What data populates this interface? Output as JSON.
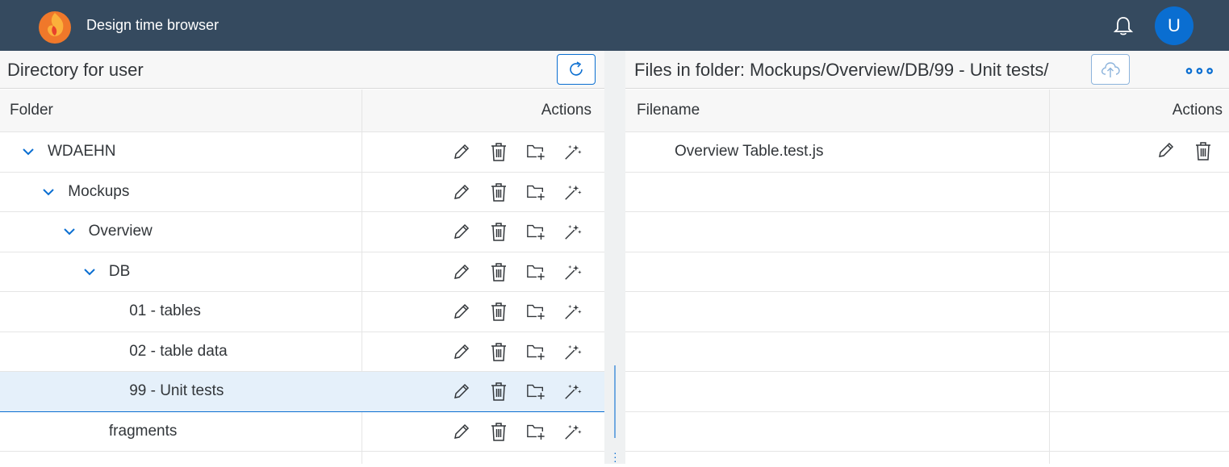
{
  "shell": {
    "title": "Design time browser",
    "avatar_initial": "U",
    "icons": [
      "app-logo-icon",
      "bell-icon"
    ]
  },
  "left_panel": {
    "title": "Directory for user",
    "columns": [
      "Folder",
      "Actions"
    ],
    "rows": [
      {
        "label": "WDAEHN",
        "expanded": true
      },
      {
        "label": "Mockups",
        "expanded": true
      },
      {
        "label": "Overview",
        "expanded": true
      },
      {
        "label": "DB",
        "expanded": true
      },
      {
        "label": "01 - tables",
        "expanded": false
      },
      {
        "label": "02 - table data",
        "expanded": false
      },
      {
        "label": "99 - Unit tests",
        "expanded": false,
        "selected": true
      },
      {
        "label": "fragments",
        "expanded": false
      }
    ],
    "row_action_icons": [
      "edit-icon",
      "delete-icon",
      "new-folder-icon",
      "magic-wand-icon"
    ]
  },
  "right_panel": {
    "title": "Files in folder: Mockups/Overview/DB/99 - Unit tests/",
    "columns": [
      "Filename",
      "Actions"
    ],
    "files": [
      "Overview Table.test.js"
    ],
    "file_action_icons": [
      "edit-icon",
      "delete-icon"
    ]
  },
  "colors": {
    "shell": "#354a5f",
    "accent": "#0a6ed1",
    "selected_row": "#e5f0fa"
  }
}
